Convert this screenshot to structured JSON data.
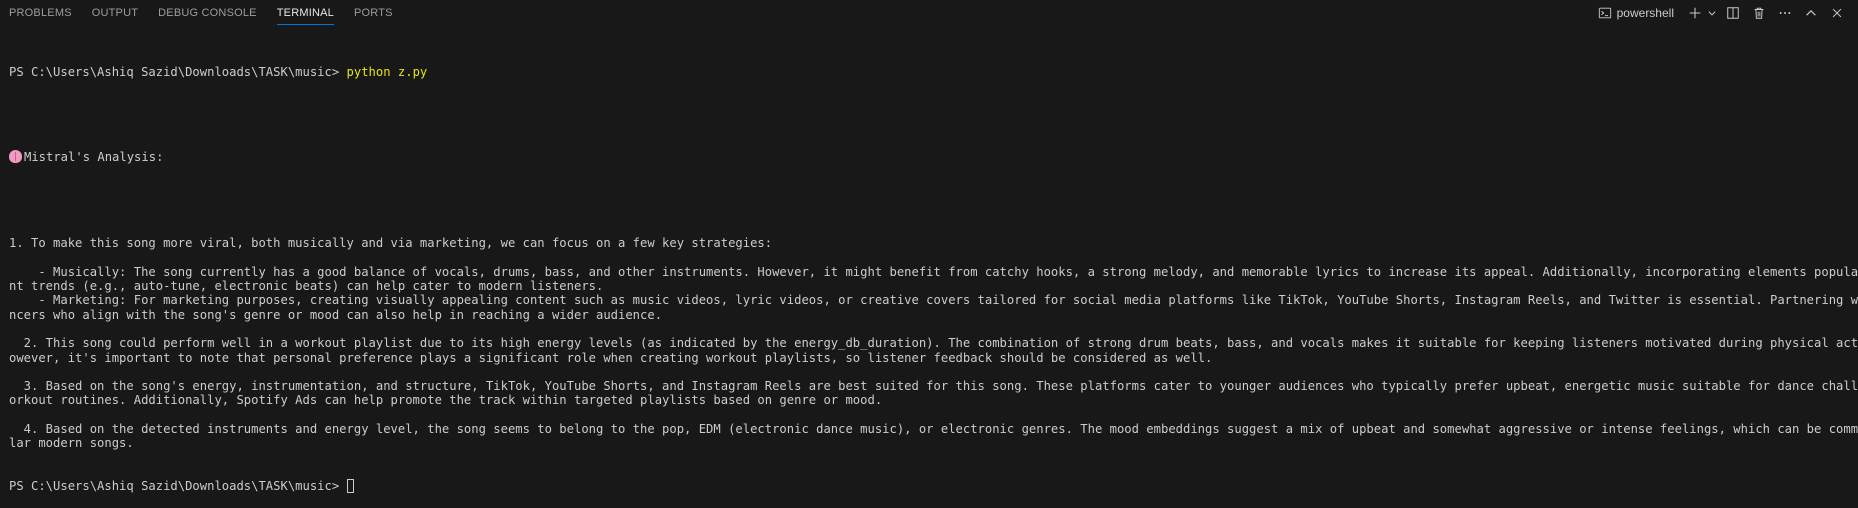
{
  "panel": {
    "tabs": [
      {
        "label": "PROBLEMS",
        "active": false
      },
      {
        "label": "OUTPUT",
        "active": false
      },
      {
        "label": "DEBUG CONSOLE",
        "active": false
      },
      {
        "label": "TERMINAL",
        "active": true
      },
      {
        "label": "PORTS",
        "active": false
      }
    ],
    "terminal_name": "powershell",
    "icons": [
      "terminal-icon",
      "plus-icon",
      "chevron-down-icon",
      "split-icon",
      "trash-icon",
      "more-icon",
      "chevron-up-icon",
      "close-icon"
    ],
    "accent_color": "#0078d4"
  },
  "terminal": {
    "prompt": "PS C:\\Users\\Ashiq Sazid\\Downloads\\TASK\\music> ",
    "command": "python z.py",
    "analysis_header": "Mistral's Analysis:",
    "lines": [
      "1. To make this song more viral, both musically and via marketing, we can focus on a few key strategies:",
      "",
      "    - Musically: The song currently has a good balance of vocals, drums, bass, and other instruments. However, it might benefit from catchy hooks, a strong melody, and memorable lyrics to increase its appeal. Additionally, incorporating elements popular in curre",
      "nt trends (e.g., auto-tune, electronic beats) can help cater to modern listeners.",
      "    - Marketing: For marketing purposes, creating visually appealing content such as music videos, lyric videos, or creative covers tailored for social media platforms like TikTok, YouTube Shorts, Instagram Reels, and Twitter is essential. Partnering with influe",
      "ncers who align with the song's genre or mood can also help in reaching a wider audience.",
      "",
      "  2. This song could perform well in a workout playlist due to its high energy levels (as indicated by the energy_db_duration). The combination of strong drum beats, bass, and vocals makes it suitable for keeping listeners motivated during physical activities. H",
      "owever, it's important to note that personal preference plays a significant role when creating workout playlists, so listener feedback should be considered as well.",
      "",
      "  3. Based on the song's energy, instrumentation, and structure, TikTok, YouTube Shorts, and Instagram Reels are best suited for this song. These platforms cater to younger audiences who typically prefer upbeat, energetic music suitable for dance challenges or w",
      "orkout routines. Additionally, Spotify Ads can help promote the track within targeted playlists based on genre or mood.",
      "",
      "  4. Based on the detected instruments and energy level, the song seems to belong to the pop, EDM (electronic dance music), or electronic genres. The mood embeddings suggest a mix of upbeat and somewhat aggressive or intense feelings, which can be common in popu",
      "lar modern songs."
    ],
    "command_color": "#e5e510"
  }
}
